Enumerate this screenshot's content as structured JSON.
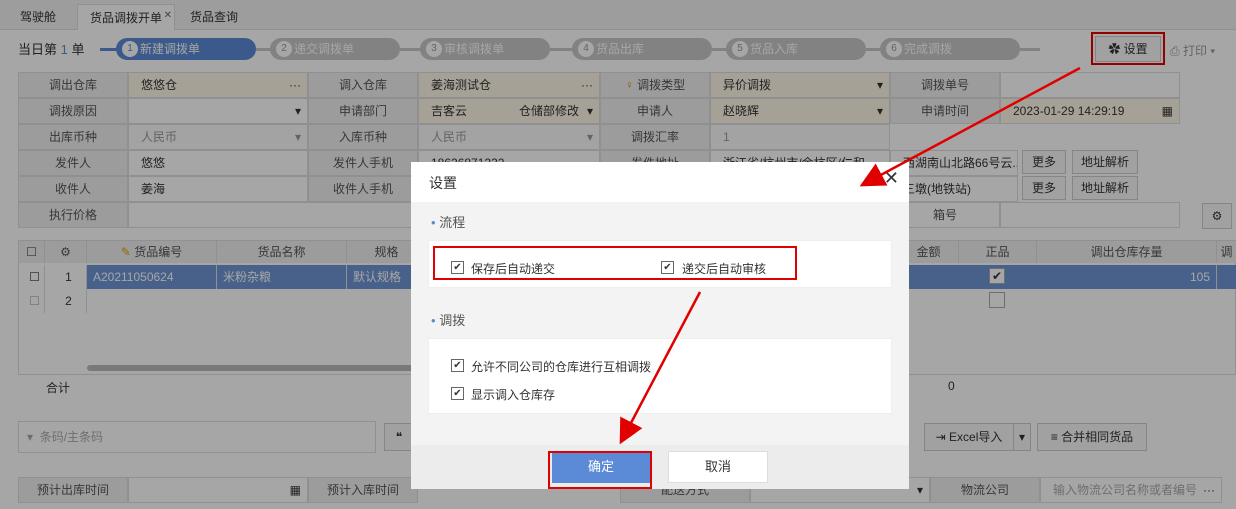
{
  "tabs": [
    "驾驶舱",
    "货品调拨开单",
    "货品查询"
  ],
  "progress": {
    "prefix": "当日第",
    "count": "1",
    "suffix": "单",
    "steps": [
      "新建调拨单",
      "递交调拨单",
      "审核调拨单",
      "货品出库",
      "货品入库",
      "完成调拨"
    ]
  },
  "toolbar": {
    "settings": "设置",
    "print": "打印"
  },
  "form": {
    "r1": [
      "调出仓库",
      "悠悠仓",
      "调入仓库",
      "姜海测试仓",
      "调拨类型",
      "异价调拨",
      "调拨单号",
      ""
    ],
    "r2": [
      "调拨原因",
      "",
      "申请部门",
      "吉客云",
      "仓储部修改",
      "申请人",
      "赵晓辉",
      "申请时间",
      "2023-01-29 14:29:19"
    ],
    "r3": [
      "出库币种",
      "人民币",
      "入库币种",
      "人民币",
      "调拨汇率",
      "1"
    ],
    "r4": [
      "发件人",
      "悠悠",
      "发件人手机",
      "18626871232",
      "发件地址",
      "浙江省/杭州市/余杭区/仁和...",
      "西湖南山北路66号云...",
      "更多",
      "地址解析"
    ],
    "r5": [
      "收件人",
      "姜海",
      "收件人手机",
      "",
      "",
      "",
      "三墩(地铁站)",
      "更多",
      "地址解析"
    ],
    "r6": [
      "执行价格",
      "",
      "箱号"
    ]
  },
  "grid": {
    "headers": [
      "",
      "",
      "货品编号",
      "货品名称",
      "规格",
      "金额",
      "正品",
      "调出仓库存量",
      "调"
    ],
    "row1": [
      "1",
      "A20211050624",
      "米粉杂粮",
      "默认规格",
      "105"
    ],
    "row2": [
      "2"
    ],
    "total_label": "合计",
    "total_value": "0"
  },
  "bottom": {
    "barcode_placeholder": "条码/主条码",
    "excel": "Excel导入",
    "merge": "合并相同货品",
    "pre_out": "预计出库时间",
    "pre_in": "预计入库时间",
    "delivery": "配送方式",
    "logistics": "物流公司",
    "logistics_placeholder": "输入物流公司名称或者编号"
  },
  "dialog": {
    "title": "设置",
    "section1": "流程",
    "opt1": "保存后自动递交",
    "opt2": "递交后自动审核",
    "section2": "调拨",
    "opt3": "允许不同公司的仓库进行互相调拨",
    "opt4": "显示调入仓库存",
    "ok": "确定",
    "cancel": "取消"
  }
}
